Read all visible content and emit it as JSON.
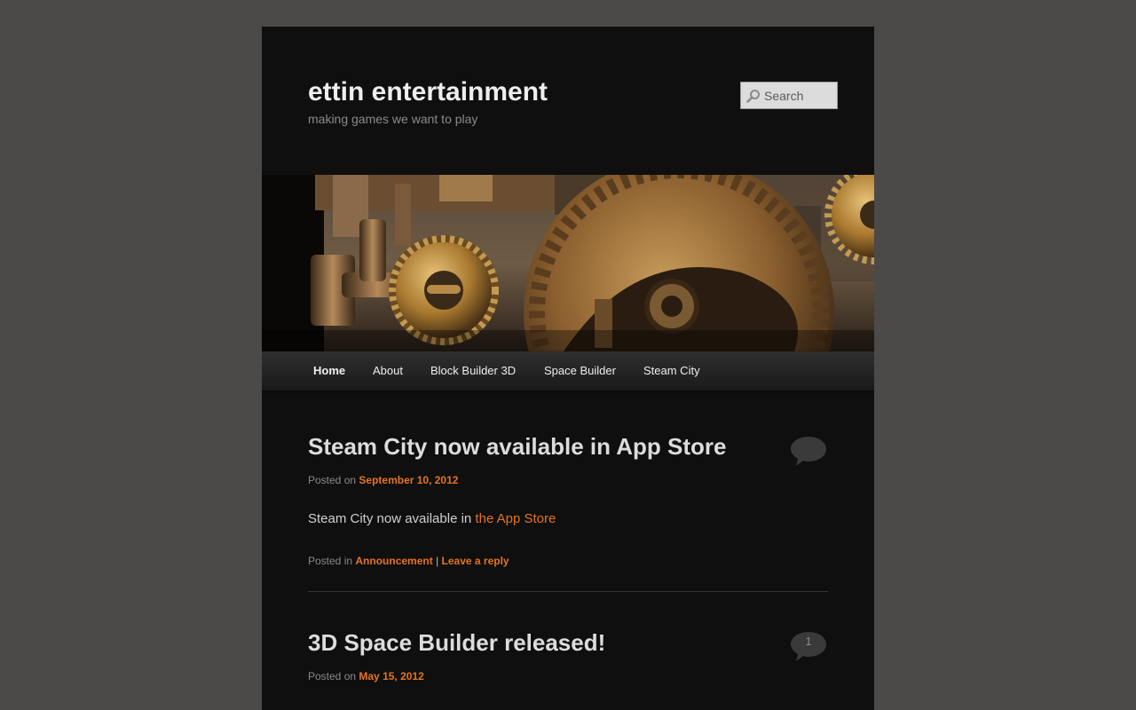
{
  "site": {
    "title": "ettin entertainment",
    "description": "making games we want to play"
  },
  "search": {
    "placeholder": "Search",
    "value": ""
  },
  "nav": {
    "items": [
      {
        "label": "Home",
        "current": true
      },
      {
        "label": "About",
        "current": false
      },
      {
        "label": "Block Builder 3D",
        "current": false
      },
      {
        "label": "Space Builder",
        "current": false
      },
      {
        "label": "Steam City",
        "current": false
      }
    ]
  },
  "posts": [
    {
      "title": "Steam City now available in App Store",
      "posted_on_label": "Posted on",
      "date": "September 10, 2012",
      "content_text": "Steam City now available in",
      "content_link": "the App Store",
      "posted_in_label": "Posted in",
      "category": "Announcement",
      "separator": "|",
      "reply_label": "Leave a reply",
      "comment_count": ""
    },
    {
      "title": "3D Space Builder released!",
      "posted_on_label": "Posted on",
      "date": "May 15, 2012",
      "comment_count": "1"
    }
  ],
  "colors": {
    "page_bg": "#4b4a48",
    "content_bg": "#0f0f0f",
    "accent": "#e4741f",
    "title_text": "#dcdcdc",
    "meta_text": "#8a8a8a"
  },
  "icons": {
    "search": "magnifier-icon",
    "comments": "speech-bubble-icon"
  }
}
